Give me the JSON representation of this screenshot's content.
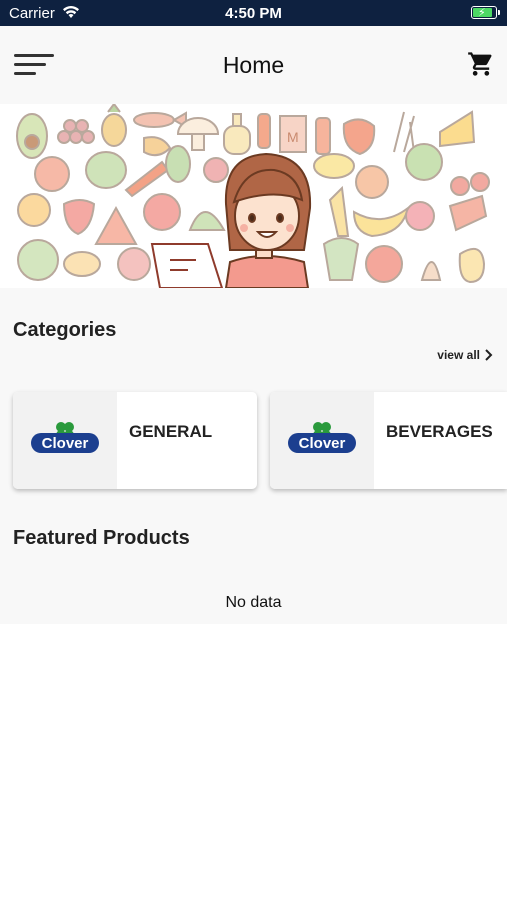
{
  "status_bar": {
    "carrier": "Carrier",
    "time": "4:50 PM",
    "wifi_icon": "wifi-icon",
    "battery_icon": "battery-charging-icon",
    "background": "#0e2140"
  },
  "header": {
    "title": "Home",
    "menu_icon": "hamburger-menu-icon",
    "cart_icon": "shopping-cart-icon"
  },
  "banner": {
    "image": "grocery-illustration-with-shopkeeper"
  },
  "categories": {
    "title": "Categories",
    "view_all": "view all",
    "items": [
      {
        "name": "GENERAL",
        "logo_text": "Clover"
      },
      {
        "name": "BEVERAGES",
        "logo_text": "Clover"
      }
    ]
  },
  "featured": {
    "title": "Featured Products",
    "empty_text": "No data"
  },
  "colors": {
    "logo_blue": "#1c3f8f",
    "logo_green": "#2a9a3c"
  }
}
